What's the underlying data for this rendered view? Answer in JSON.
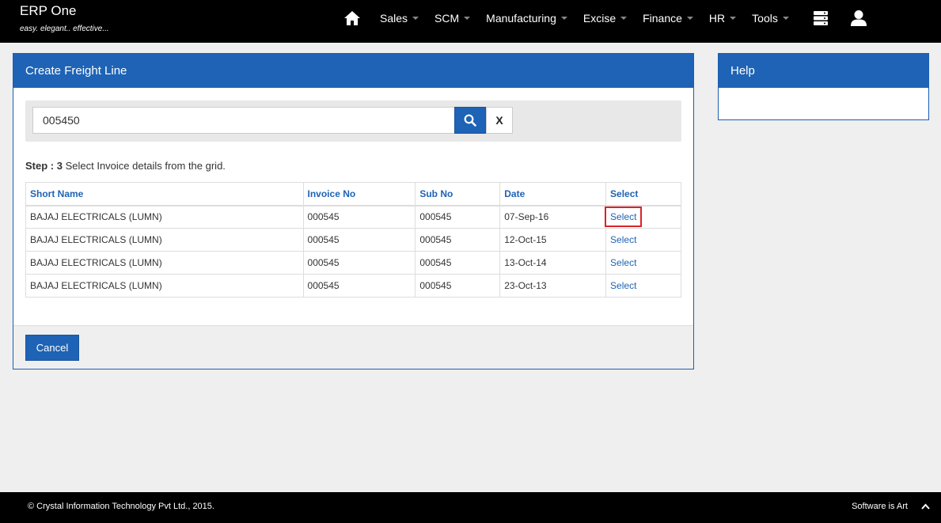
{
  "brand": {
    "title": "ERP One",
    "tagline": "easy. elegant.. effective..."
  },
  "nav": {
    "items": [
      {
        "label": "Sales"
      },
      {
        "label": "SCM"
      },
      {
        "label": "Manufacturing"
      },
      {
        "label": "Excise"
      },
      {
        "label": "Finance"
      },
      {
        "label": "HR"
      },
      {
        "label": "Tools"
      }
    ]
  },
  "panel": {
    "title": "Create Freight Line",
    "search": {
      "value": "005450",
      "clear_label": "X"
    },
    "step": {
      "prefix": "Step : 3",
      "text": "Select Invoice details from the grid."
    },
    "grid": {
      "headers": [
        "Short Name",
        "Invoice No",
        "Sub No",
        "Date",
        "Select"
      ],
      "rows": [
        {
          "short_name": "BAJAJ ELECTRICALS (LUMN)",
          "invoice_no": "000545",
          "sub_no": "000545",
          "date": "07-Sep-16",
          "select": "Select"
        },
        {
          "short_name": "BAJAJ ELECTRICALS (LUMN)",
          "invoice_no": "000545",
          "sub_no": "000545",
          "date": "12-Oct-15",
          "select": "Select"
        },
        {
          "short_name": "BAJAJ ELECTRICALS (LUMN)",
          "invoice_no": "000545",
          "sub_no": "000545",
          "date": "13-Oct-14",
          "select": "Select"
        },
        {
          "short_name": "BAJAJ ELECTRICALS (LUMN)",
          "invoice_no": "000545",
          "sub_no": "000545",
          "date": "23-Oct-13",
          "select": "Select"
        }
      ]
    },
    "cancel_label": "Cancel"
  },
  "help": {
    "title": "Help"
  },
  "footer": {
    "copyright": "© Crystal Information Technology Pvt Ltd., 2015.",
    "slogan": "Software is Art"
  },
  "colors": {
    "primary": "#1e63b5",
    "highlight": "#d9232a",
    "topbar": "#000000"
  }
}
